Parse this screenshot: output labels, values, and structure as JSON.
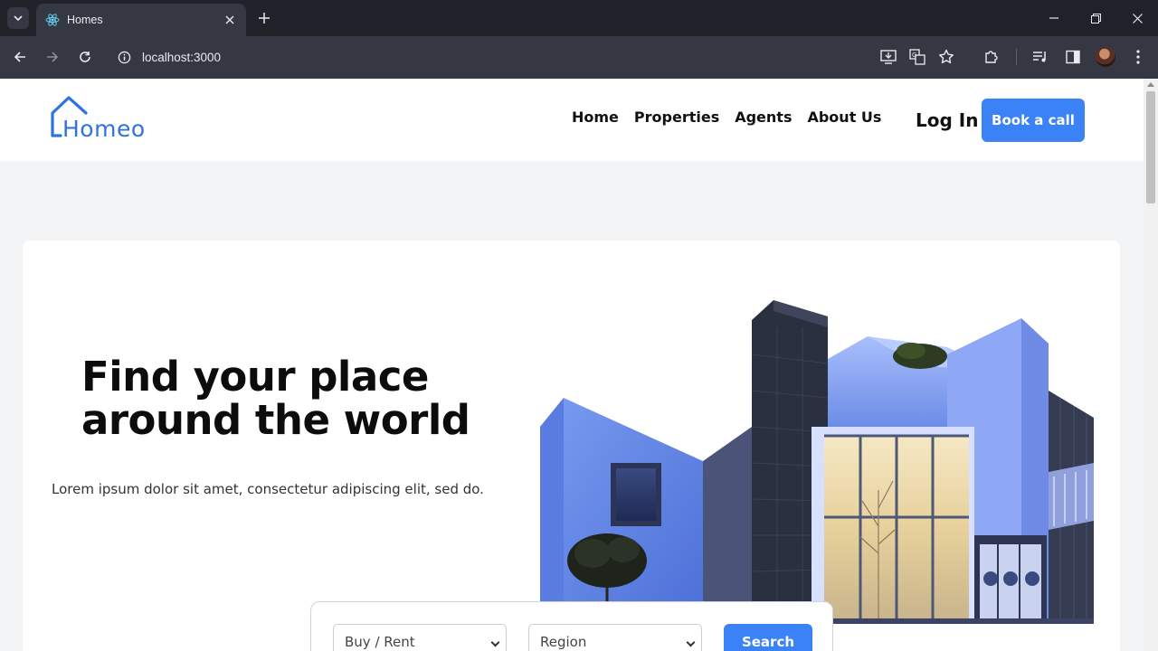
{
  "browser": {
    "tab_title": "Homes",
    "url": "localhost:3000"
  },
  "site": {
    "logo_text": "Homeo",
    "nav": [
      "Home",
      "Properties",
      "Agents",
      "About Us"
    ],
    "login_label": "Log In",
    "book_label": "Book a call",
    "accent_color": "#3b82f6"
  },
  "hero": {
    "title_line1": "Find your place",
    "title_line2": "around the world",
    "subtitle": "Lorem ipsum dolor sit amet, consectetur adipiscing elit, sed do."
  },
  "search": {
    "mode_select": "Buy / Rent",
    "region_select": "Region",
    "button_label": "Search"
  }
}
